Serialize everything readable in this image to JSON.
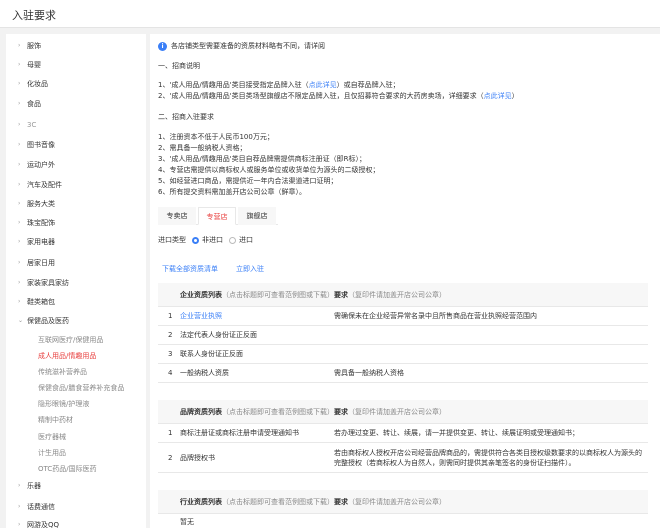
{
  "header": {
    "title": "入驻要求"
  },
  "sidebar": {
    "items": [
      {
        "label": "服饰"
      },
      {
        "label": "母婴"
      },
      {
        "label": "化妆品"
      },
      {
        "label": "食品"
      },
      {
        "label": "3C"
      },
      {
        "label": "图书音像"
      },
      {
        "label": "运动户外"
      },
      {
        "label": "汽车及配件"
      },
      {
        "label": "服务大类"
      },
      {
        "label": "珠宝配饰"
      },
      {
        "label": "家用电器"
      },
      {
        "label": "居家日用"
      },
      {
        "label": "家装家具家纺"
      },
      {
        "label": "鞋类箱包"
      },
      {
        "label": "保健品及医药"
      },
      {
        "label": "乐器"
      },
      {
        "label": "话费通信"
      },
      {
        "label": "网游及QQ"
      }
    ],
    "subitems": [
      {
        "label": "互联网医疗/保健用品"
      },
      {
        "label": "成人用品/情趣用品"
      },
      {
        "label": "传统滋补营养品"
      },
      {
        "label": "保健食品/膳食营养补充食品"
      },
      {
        "label": "隐形眼镜/护理液"
      },
      {
        "label": "精制中药材"
      },
      {
        "label": "医疗器械"
      },
      {
        "label": "计生用品"
      },
      {
        "label": "OTC药品/国际医药"
      }
    ]
  },
  "main": {
    "notice": "各店铺类型需要准备的资质材料略有不同，请详阅",
    "section1_title": "一、招商说明",
    "s1_line1_pre": "1、'成人用品/情趣用品'类目接受指定品牌入驻（",
    "s1_line1_link": "点此详见",
    "s1_line1_post": "）或自荐品牌入驻；",
    "s1_line2_pre": "2、'成人用品/情趣用品'类目类场型旗舰店不限定品牌入驻，且仅招募符合要求的大药房卖场，详细要求（",
    "s1_line2_link": "点此详见",
    "s1_line2_post": "）",
    "section2_title": "二、招商入驻要求",
    "requirements": [
      "1、注册资本不低于人民币100万元；",
      "2、需具备一般纳税人资格；",
      "3、'成人用品/情趣用品'类目自荐品牌需提供商标注册证（即R标）；",
      "4、专营店需提供以商标权人或服务单位或收货单位为源头的二级授权；",
      "5、如经营进口商品，需提供近一年内合法渠道进口证明；",
      "6、所有提交资料需加盖开店公司公章（鲜章）。"
    ],
    "tabs": [
      {
        "label": "专卖店"
      },
      {
        "label": "专营店"
      },
      {
        "label": "旗舰店"
      }
    ],
    "import_label": "进口类型",
    "radio_no": "非进口",
    "radio_yes": "进口",
    "download_link": "下载全部资质清单",
    "apply_link": "立即入驻",
    "company_section": {
      "title": "企业资质列表",
      "title_note": "（点击标题即可查看范例图或下载）",
      "req_title": "要求",
      "req_note": "（复印件请加盖开店公司公章）",
      "rows": [
        {
          "n": "1",
          "name": "企业营业执照",
          "req": "需确保未在企业经营异常名录中且所售商品在营业执照经营范围内"
        },
        {
          "n": "2",
          "name": "法定代表人身份证正反面",
          "req": ""
        },
        {
          "n": "3",
          "name": "联系人身份证正反面",
          "req": ""
        },
        {
          "n": "4",
          "name": "一般纳税人资质",
          "req": "需具备一般纳税人资格"
        }
      ]
    },
    "brand_section": {
      "title": "品牌资质列表",
      "title_note": "（点击标题即可查看范例图或下载）",
      "req_title": "要求",
      "req_note": "（复印件请加盖开店公司公章）",
      "rows": [
        {
          "n": "1",
          "name": "商标注册证或商标注册申请受理通知书",
          "req": "若办理过变更、转让、续展，请一并提供变更、转让、续展证明或受理通知书；"
        },
        {
          "n": "2",
          "name": "品牌授权书",
          "req": "若由商标权人授权开店公司经营品牌商品的，需提供符合各类目授权级数要求的以商标权人为源头的完整授权（若商标权人为自然人，则需同时提供其亲笔签名的身份证扫描件）。"
        }
      ]
    },
    "industry_section": {
      "title": "行业资质列表",
      "title_note": "（点击标题即可查看范例图或下载）",
      "req_title": "要求",
      "req_note": "（复印件请加盖开店公司公章）",
      "empty": "暂无"
    }
  },
  "colors": {
    "accent": "#e8403f",
    "link": "#3a7ff7"
  }
}
